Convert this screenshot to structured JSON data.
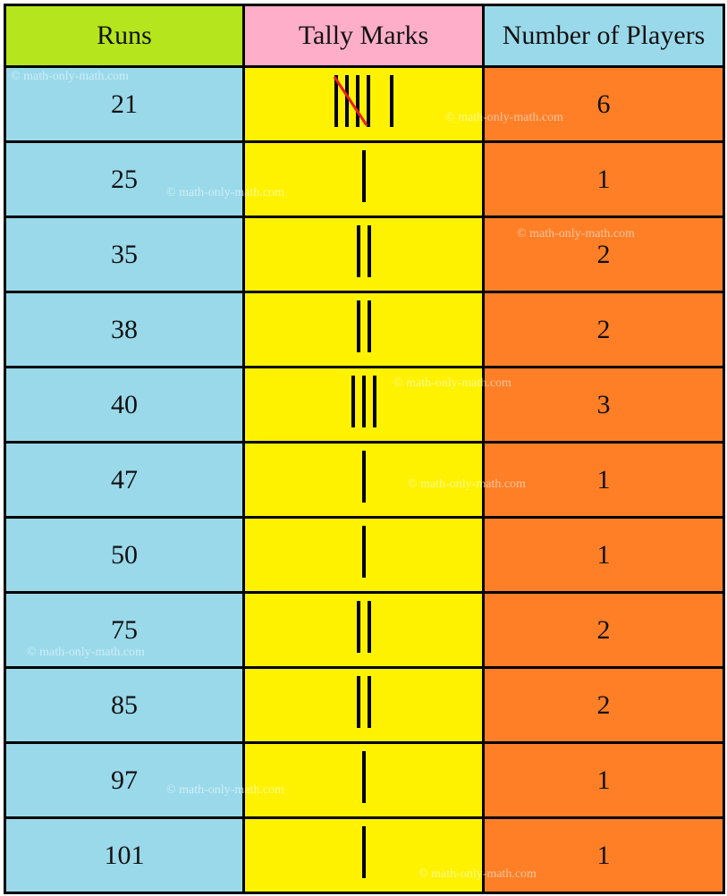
{
  "headers": {
    "runs": "Runs",
    "tally": "Tally Marks",
    "players": "Number of Players"
  },
  "watermark": "© math-only-math.com",
  "rows": [
    {
      "runs": "21",
      "tally_count": 6,
      "players": "6"
    },
    {
      "runs": "25",
      "tally_count": 1,
      "players": "1"
    },
    {
      "runs": "35",
      "tally_count": 2,
      "players": "2"
    },
    {
      "runs": "38",
      "tally_count": 2,
      "players": "2"
    },
    {
      "runs": "40",
      "tally_count": 3,
      "players": "3"
    },
    {
      "runs": "47",
      "tally_count": 1,
      "players": "1"
    },
    {
      "runs": "50",
      "tally_count": 1,
      "players": "1"
    },
    {
      "runs": "75",
      "tally_count": 2,
      "players": "2"
    },
    {
      "runs": "85",
      "tally_count": 2,
      "players": "2"
    },
    {
      "runs": "97",
      "tally_count": 1,
      "players": "1"
    },
    {
      "runs": "101",
      "tally_count": 1,
      "players": "1"
    }
  ],
  "colors": {
    "header_runs": "#b5e61d",
    "header_tally": "#ffaec9",
    "header_players": "#99d9ea",
    "runs_col": "#99d9ea",
    "tally_col": "#fff200",
    "players_col": "#ff7f27",
    "tally_slash": "#ed1c24"
  }
}
